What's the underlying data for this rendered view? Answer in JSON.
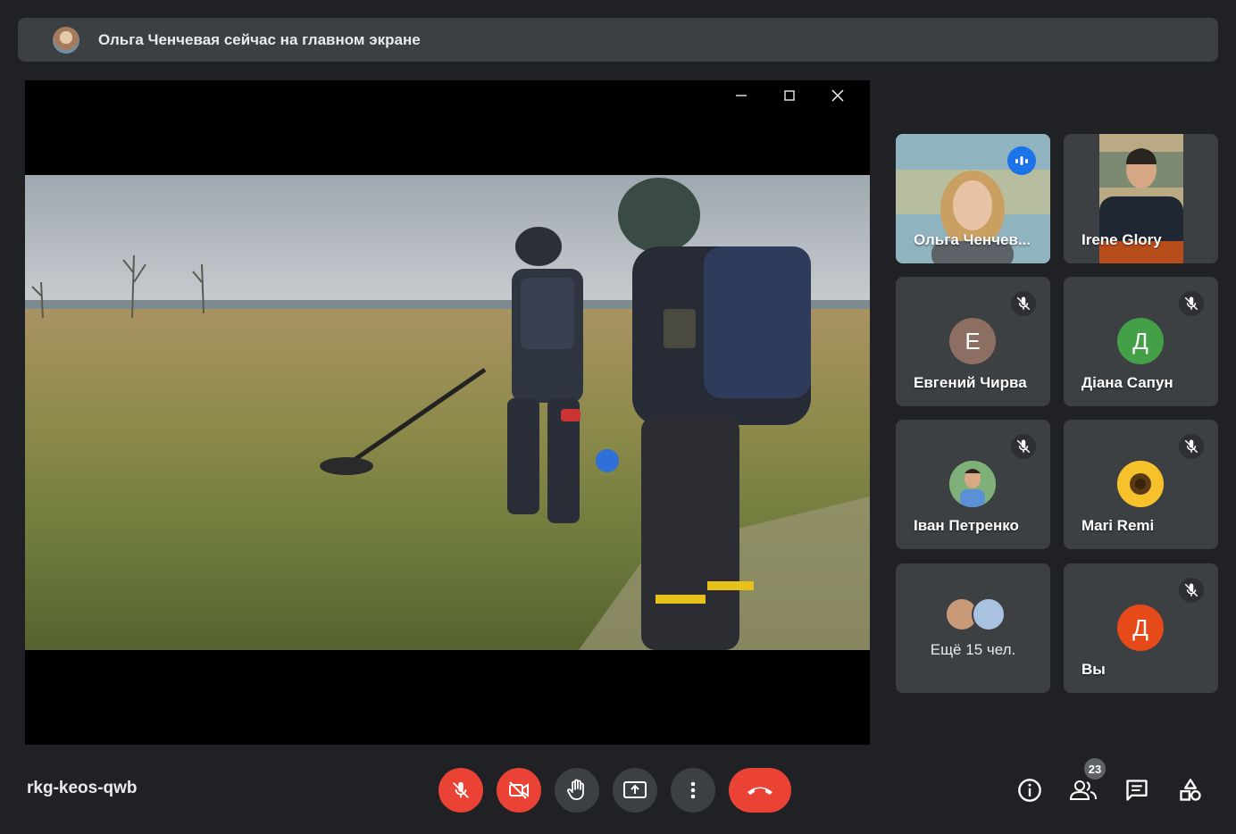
{
  "banner": {
    "text": "Ольга Ченчевая сейчас на главном экране"
  },
  "stage": {
    "window_controls": [
      "minimize-icon",
      "maximize-icon",
      "close-icon"
    ]
  },
  "participants": [
    {
      "name": "Ольга Ченчев...",
      "speaking": true
    },
    {
      "name": "Irene Glory"
    },
    {
      "name": "Евгений Чирва",
      "initial": "Е",
      "color": "#8d6e63",
      "muted": true
    },
    {
      "name": "Діана Сапун",
      "initial": "Д",
      "color": "#43a047",
      "muted": true
    },
    {
      "name": "Іван Петренко",
      "muted": true
    },
    {
      "name": "Mari Remi",
      "muted": true
    },
    {
      "name": "Ещё 15 чел."
    },
    {
      "name": "Вы",
      "initial": "Д",
      "color": "#e64a19",
      "muted": true
    }
  ],
  "meeting": {
    "code": "rkg-keos-qwb"
  },
  "toolbar": {
    "buttons": [
      "mic-off-icon",
      "camera-off-icon",
      "raise-hand-icon",
      "present-icon",
      "more-icon",
      "end-call-icon"
    ],
    "accent_red": "#ea4335"
  },
  "side_actions": {
    "people_count": "23",
    "icons": [
      "info-icon",
      "people-icon",
      "chat-icon",
      "activities-icon"
    ]
  }
}
